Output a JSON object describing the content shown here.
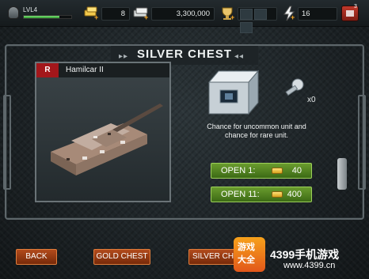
{
  "topbar": {
    "level": "LVL4",
    "xp_fraction": 0.75,
    "gold_amount": "8",
    "cash_amount": "3,300,000",
    "energy_amount": "16",
    "notification_count": "3"
  },
  "title": "SILVER CHEST",
  "unit": {
    "rarity": "R",
    "name": "Hamilcar II"
  },
  "chest": {
    "key_count": "x0",
    "chance_text": "Chance for uncommon unit and chance for rare unit."
  },
  "offers": [
    {
      "label": "OPEN 1:",
      "cost": "40"
    },
    {
      "label": "OPEN 11:",
      "cost": "400"
    }
  ],
  "buttons": {
    "back": "BACK",
    "gold_chest": "GOLD CHEST",
    "silver_chest": "SILVER CHEST"
  },
  "watermark": {
    "icon_top": "游戏",
    "icon_bottom": "大全",
    "brand": "4399手机游戏",
    "url": "www.4399.cn"
  },
  "colors": {
    "rarity_red": "#a3171b",
    "open_green": "#6a9c2e",
    "action_orange": "#b24b1c"
  }
}
